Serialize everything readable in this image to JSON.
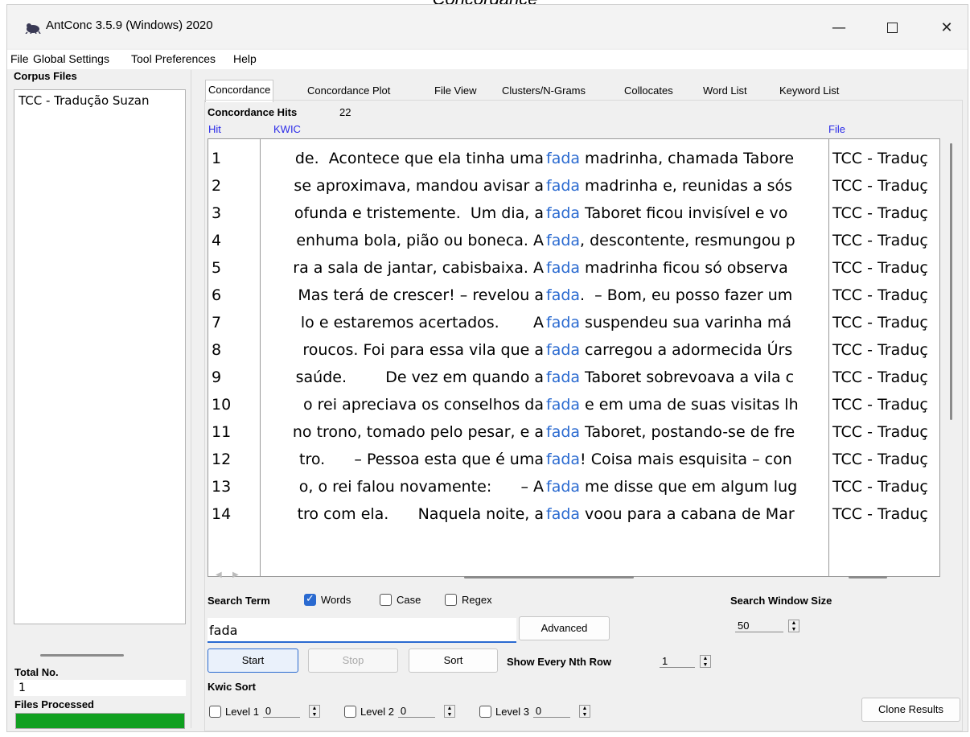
{
  "caption": "Concordance",
  "window": {
    "title": "AntConc 3.5.9 (Windows) 2020"
  },
  "menu": [
    "File",
    "Global Settings",
    "Tool Preferences",
    "Help"
  ],
  "left_panel": {
    "corpus_files_label": "Corpus Files",
    "files": [
      "TCC - Tradução Suzan"
    ],
    "total_no_label": "Total No.",
    "total_no_value": "1",
    "files_processed_label": "Files Processed",
    "progress_fraction": 1.0,
    "progress_color": "#10a020"
  },
  "tabs": [
    "Concordance",
    "Concordance Plot",
    "File View",
    "Clusters/N-Grams",
    "Collocates",
    "Word List",
    "Keyword List"
  ],
  "active_tab": "Concordance",
  "concordance": {
    "hits_label": "Concordance Hits",
    "hits_value": "22",
    "columns": {
      "hit": "Hit",
      "kwic": "KWIC",
      "file": "File"
    },
    "rows": [
      {
        "hit": "1",
        "left": "de.  Acontece que ela tinha uma",
        "node": "fada",
        "right": "madrinha, chamada Tabore",
        "file": "TCC - Traduç"
      },
      {
        "hit": "2",
        "left": "se aproximava, mandou avisar a",
        "node": "fada",
        "right": "madrinha e, reunidas a sós",
        "file": "TCC - Traduç"
      },
      {
        "hit": "3",
        "left": "ofunda e tristemente.  Um dia, a",
        "node": "fada",
        "right": "Taboret ficou invisível e vo",
        "file": "TCC - Traduç"
      },
      {
        "hit": "4",
        "left": "enhuma bola, pião ou boneca. A",
        "node": "fada",
        "right": ", descontente, resmungou p",
        "file": "TCC - Traduç"
      },
      {
        "hit": "5",
        "left": "ra a sala de jantar, cabisbaixa. A",
        "node": "fada",
        "right": "madrinha ficou só observa",
        "file": "TCC - Traduç"
      },
      {
        "hit": "6",
        "left": "Mas terá de crescer! – revelou a",
        "node": "fada",
        "right": ".  – Bom, eu posso fazer um",
        "file": "TCC - Traduç"
      },
      {
        "hit": "7",
        "left": "lo e estaremos acertados.       A",
        "node": "fada",
        "right": "suspendeu sua varinha má",
        "file": "TCC - Traduç"
      },
      {
        "hit": "8",
        "left": "roucos. Foi para essa vila que a",
        "node": "fada",
        "right": "carregou a adormecida Úrs",
        "file": "TCC - Traduç"
      },
      {
        "hit": "9",
        "left": "saúde.        De vez em quando a",
        "node": "fada",
        "right": "Taboret sobrevoava a vila c",
        "file": "TCC - Traduç"
      },
      {
        "hit": "10",
        "left": "o rei apreciava os conselhos da",
        "node": "fada",
        "right": "e em uma de suas visitas lh",
        "file": "TCC - Traduç"
      },
      {
        "hit": "11",
        "left": "no trono, tomado pelo pesar, e a",
        "node": "fada",
        "right": "Taboret, postando-se de fre",
        "file": "TCC - Traduç"
      },
      {
        "hit": "12",
        "left": "tro.      – Pessoa esta que é uma",
        "node": "fada",
        "right": "! Coisa mais esquisita – con",
        "file": "TCC - Traduç"
      },
      {
        "hit": "13",
        "left": "o, o rei falou novamente:      – A",
        "node": "fada",
        "right": "me disse que em algum lug",
        "file": "TCC - Traduç"
      },
      {
        "hit": "14",
        "left": "tro com ela.      Naquela noite, a",
        "node": "fada",
        "right": "voou para a cabana de Mar",
        "file": "TCC - Traduç"
      }
    ]
  },
  "search": {
    "term_label": "Search Term",
    "words_label": "Words",
    "words_checked": true,
    "case_label": "Case",
    "case_checked": false,
    "regex_label": "Regex",
    "regex_checked": false,
    "value": "fada",
    "advanced_label": "Advanced",
    "window_size_label": "Search Window Size",
    "window_size_value": "50"
  },
  "controls": {
    "start_label": "Start",
    "stop_label": "Stop",
    "sort_label": "Sort",
    "nth_row_label": "Show Every Nth Row",
    "nth_row_value": "1",
    "kwic_sort_label": "Kwic Sort",
    "levels": [
      {
        "label": "Level 1",
        "value": "0"
      },
      {
        "label": "Level 2",
        "value": "0"
      },
      {
        "label": "Level 3",
        "value": "0"
      }
    ],
    "clone_label": "Clone Results"
  },
  "colors": {
    "accent": "#2a6ad0",
    "node_word": "#2a6ad0",
    "column_header": "#2a2ae8"
  }
}
